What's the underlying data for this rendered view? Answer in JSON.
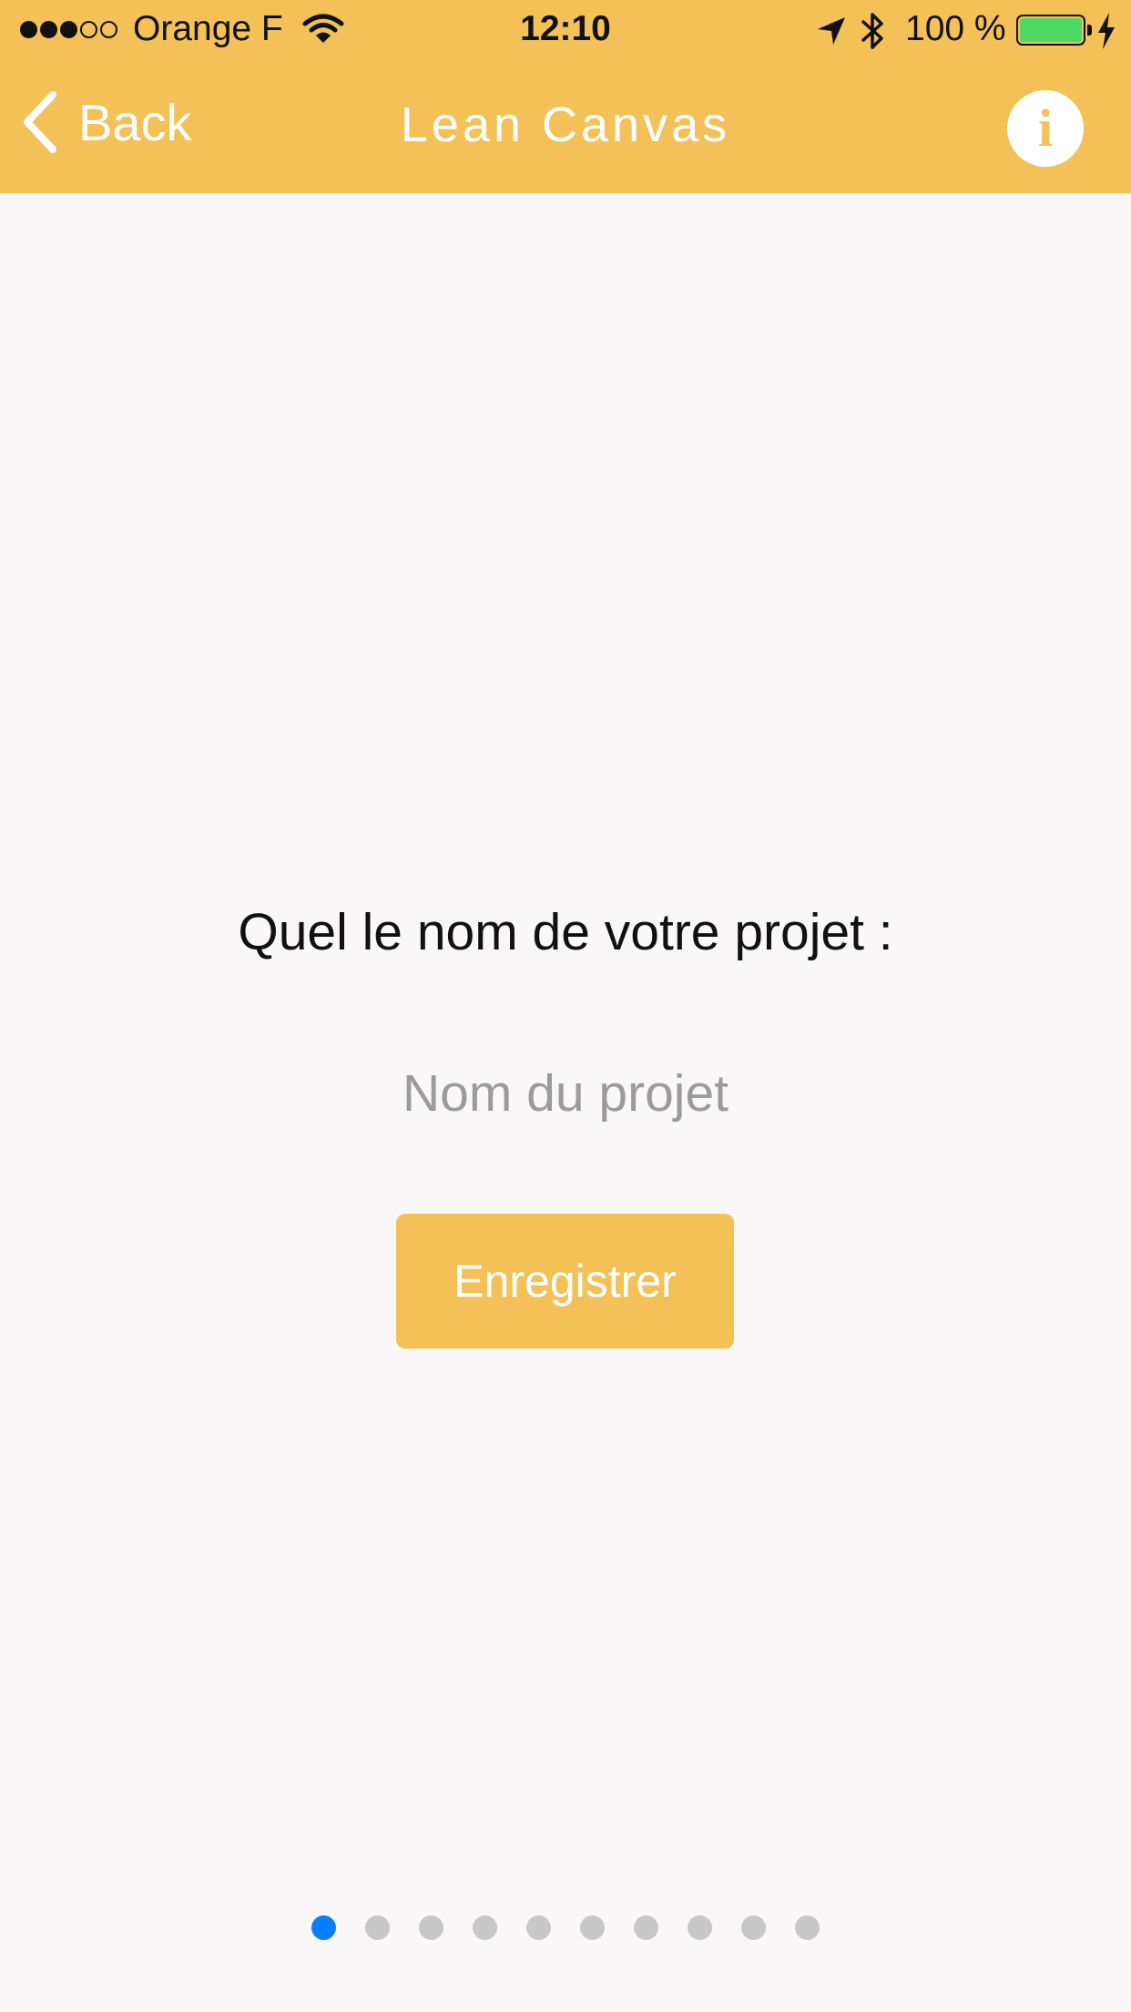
{
  "status_bar": {
    "signal": {
      "filled": 3,
      "total": 5
    },
    "carrier": "Orange F",
    "time": "12:10",
    "battery_percent": "100 %",
    "battery_level": 1.0,
    "battery_color": "#4cd964",
    "icons": [
      "wifi-icon",
      "location-arrow-icon",
      "bluetooth-icon",
      "battery-icon",
      "charging-bolt-icon"
    ]
  },
  "nav": {
    "back_label": "Back",
    "title": "Lean Canvas",
    "info_glyph": "i",
    "back_icon": "chevron-left-icon",
    "info_icon": "info-icon",
    "background_color": "#f3c157"
  },
  "form": {
    "question": "Quel le nom de votre projet :",
    "input_value": "",
    "input_placeholder": "Nom du projet",
    "save_label": "Enregistrer",
    "button_color": "#f3c157"
  },
  "pagination": {
    "total": 10,
    "current": 1,
    "active_color": "#0a7cff",
    "inactive_color": "#c8c8c8"
  }
}
